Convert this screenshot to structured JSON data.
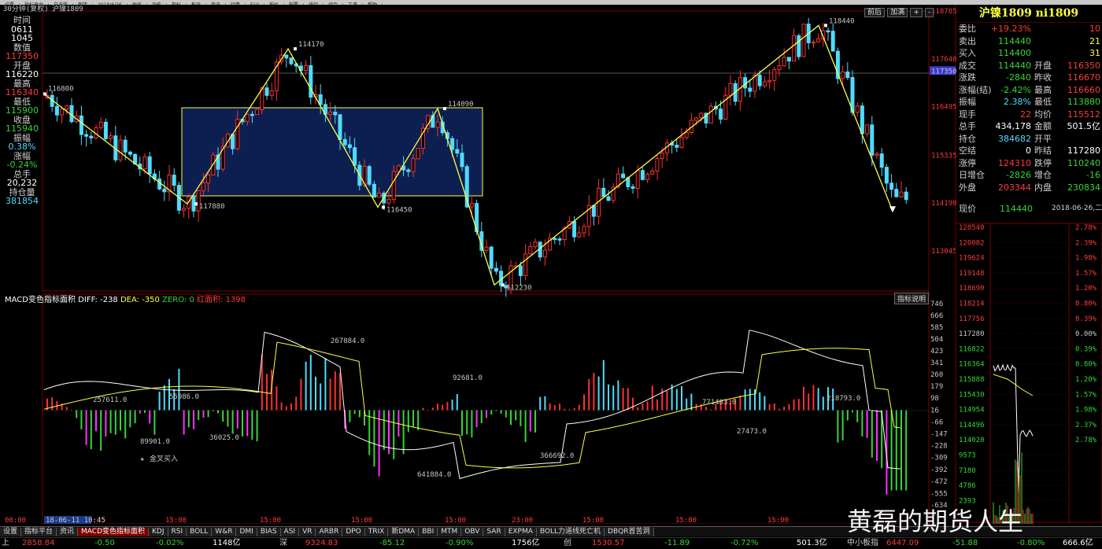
{
  "menubar": {
    "items": [
      "设置",
      "指标平台",
      "自选股",
      "期货",
      "2018/6/26",
      "画线",
      "功能",
      "指标",
      "板块",
      "资讯",
      "行情",
      "F10",
      "报价",
      "配置",
      "排行",
      "组合",
      "工具",
      "帮助"
    ]
  },
  "chart": {
    "period_label": "30分钟(复权)",
    "symbol": "沪镍1809",
    "top_controls": [
      "前后",
      "加满",
      "+",
      "-"
    ],
    "price_ticks": [
      "118785",
      "117640",
      "117350",
      "116495",
      "115335",
      "114190",
      "113045"
    ],
    "peak_labels": [
      "116800",
      "117880",
      "114170",
      "116450",
      "114090",
      "112230",
      "118440"
    ],
    "indicator_header": {
      "name": "MACD变色指标面积",
      "diff": "DIFF: -238",
      "dea": "DEA: -350",
      "zero": "ZERO: 0",
      "red_area": "红面积: 1398",
      "explain": "指标说明"
    },
    "macd_ticks": [
      "746",
      "666",
      "585",
      "504",
      "423",
      "341",
      "260",
      "179",
      "98",
      "16",
      "-66",
      "-147",
      "-228",
      "-309",
      "-392",
      "-472",
      "-555",
      "-634"
    ],
    "area_labels": [
      "257611.0",
      "55986.0",
      "267884.0",
      "92681.0",
      "771483.0",
      "218793.0",
      "89901.0",
      "36025.0",
      "641884.0",
      "366692.0",
      "27473.0"
    ],
    "signal_label": "金叉买入",
    "time_axis": [
      "00:00",
      "18-06-11 10:45",
      "15:00",
      "15:00",
      "15:00",
      "15:00",
      "23:00",
      "15:00",
      "15:00",
      "15:00"
    ]
  },
  "left_panel": {
    "rows": [
      {
        "label": "时间",
        "cls": "lab"
      },
      {
        "label": "0611",
        "cls": "wht"
      },
      {
        "label": "1045",
        "cls": "wht"
      },
      {
        "label": "数值",
        "cls": "lab"
      },
      {
        "label": "117350",
        "cls": "red"
      },
      {
        "label": "开盘",
        "cls": "lab"
      },
      {
        "label": "116220",
        "cls": "wht"
      },
      {
        "label": "最高",
        "cls": "lab"
      },
      {
        "label": "116340",
        "cls": "red"
      },
      {
        "label": "最低",
        "cls": "lab"
      },
      {
        "label": "115900",
        "cls": "grn"
      },
      {
        "label": "收盘",
        "cls": "lab"
      },
      {
        "label": "115940",
        "cls": "grn"
      },
      {
        "label": "振幅",
        "cls": "lab"
      },
      {
        "label": "0.38%",
        "cls": "cyan"
      },
      {
        "label": "涨幅",
        "cls": "lab"
      },
      {
        "label": "-0.24%",
        "cls": "grn"
      },
      {
        "label": "总手",
        "cls": "lab"
      },
      {
        "label": "20,232",
        "cls": "wht"
      },
      {
        "label": "持仓量",
        "cls": "lab"
      },
      {
        "label": "381854",
        "cls": "cyan"
      }
    ]
  },
  "quote": {
    "title": "沪镍1809 ni1809",
    "rows": [
      {
        "a": "委比",
        "av": "+19.23%",
        "avc": "red",
        "b": "",
        "bv": "10",
        "bvc": "red"
      },
      {
        "a": "卖出",
        "av": "114440",
        "avc": "grn",
        "b": "",
        "bv": "21",
        "bvc": "yel"
      },
      {
        "a": "买入",
        "av": "114400",
        "avc": "grn",
        "b": "",
        "bv": "31",
        "bvc": "yel"
      },
      {
        "a": "成交",
        "av": "114440",
        "avc": "grn",
        "b": "开盘",
        "bv": "116350",
        "bvc": "red"
      },
      {
        "a": "涨跌",
        "av": "-2840",
        "avc": "grn",
        "b": "昨收",
        "bv": "116670",
        "bvc": "red"
      },
      {
        "a": "涨幅(结)",
        "av": "-2.42%",
        "avc": "grn",
        "b": "最高",
        "bv": "116660",
        "bvc": "red"
      },
      {
        "a": "振幅",
        "av": "2.38%",
        "avc": "cyan",
        "b": "最低",
        "bv": "113880",
        "bvc": "grn"
      },
      {
        "a": "现手",
        "av": "22",
        "avc": "red",
        "b": "均价",
        "bv": "115512",
        "bvc": "red"
      },
      {
        "a": "总手",
        "av": "434,178",
        "avc": "wht",
        "b": "金额",
        "bv": "501.5亿",
        "bvc": "wht"
      },
      {
        "a": "持仓",
        "av": "384682",
        "avc": "cyan",
        "b": "开平",
        "bv": "",
        "bvc": "wht"
      },
      {
        "a": "空结",
        "av": "0",
        "avc": "wht",
        "b": "昨结",
        "bv": "117280",
        "bvc": "wht"
      },
      {
        "a": "涨停",
        "av": "124310",
        "avc": "red",
        "b": "跌停",
        "bv": "110240",
        "bvc": "grn"
      },
      {
        "a": "日增仓",
        "av": "-2826",
        "avc": "grn",
        "b": "增仓",
        "bv": "-16",
        "bvc": "grn"
      },
      {
        "a": "外盘",
        "av": "203344",
        "avc": "red",
        "b": "内盘",
        "bv": "230834",
        "bvc": "grn"
      }
    ],
    "now_label": "现价",
    "now_value": "114440",
    "now_date": "2018-06-26,二",
    "mini_left_ticks": [
      "120540",
      "120082",
      "119624",
      "119148",
      "118690",
      "118214",
      "117756",
      "117280",
      "116822",
      "116364",
      "115888",
      "115430",
      "114954",
      "114496",
      "114020",
      "9573",
      "7180",
      "4786",
      "2393"
    ],
    "mini_right_ticks": [
      "2.78%",
      "2.39%",
      "1.98%",
      "1.57%",
      "1.20%",
      "0.80%",
      "0.39%",
      "0.00%",
      "0.39%",
      "0.80%",
      "1.20%",
      "1.57%",
      "1.98%",
      "2.37%",
      "2.78%"
    ]
  },
  "bottom_tabs": [
    "设置",
    "指标平台",
    "资讯",
    "MACD变色指标面积",
    "KDJ",
    "RSI",
    "BOLL",
    "W&R",
    "DMI",
    "BIAS",
    "ASI",
    "VR",
    "ARBR",
    "DPO",
    "TRIX",
    "新DMA",
    "BBI",
    "MTM",
    "OBV",
    "SAR",
    "EXPMA",
    "BOLL力道线死亡机",
    "DBQR首苦洞"
  ],
  "status": [
    {
      "t": "上",
      "c": "lab"
    },
    {
      "t": "2858.84",
      "c": "red"
    },
    {
      "t": "-0.50",
      "c": "grn"
    },
    {
      "t": "-0.02%",
      "c": "grn"
    },
    {
      "t": "1148亿",
      "c": "wht"
    },
    {
      "t": "深",
      "c": "lab"
    },
    {
      "t": "9324.83",
      "c": "red"
    },
    {
      "t": "-85.12",
      "c": "grn"
    },
    {
      "t": "-0.90%",
      "c": "grn"
    },
    {
      "t": "1756亿",
      "c": "wht"
    },
    {
      "t": "创",
      "c": "lab"
    },
    {
      "t": "1530.57",
      "c": "red"
    },
    {
      "t": "-11.89",
      "c": "grn"
    },
    {
      "t": "-0.72%",
      "c": "grn"
    },
    {
      "t": "501.3亿",
      "c": "wht"
    },
    {
      "t": "中小板指",
      "c": "lab"
    },
    {
      "t": "6447.09",
      "c": "red"
    },
    {
      "t": "-51.88",
      "c": "grn"
    },
    {
      "t": "-0.80%",
      "c": "grn"
    },
    {
      "t": "666.6亿",
      "c": "wht"
    }
  ],
  "watermark": "黄磊的期货人生"
}
